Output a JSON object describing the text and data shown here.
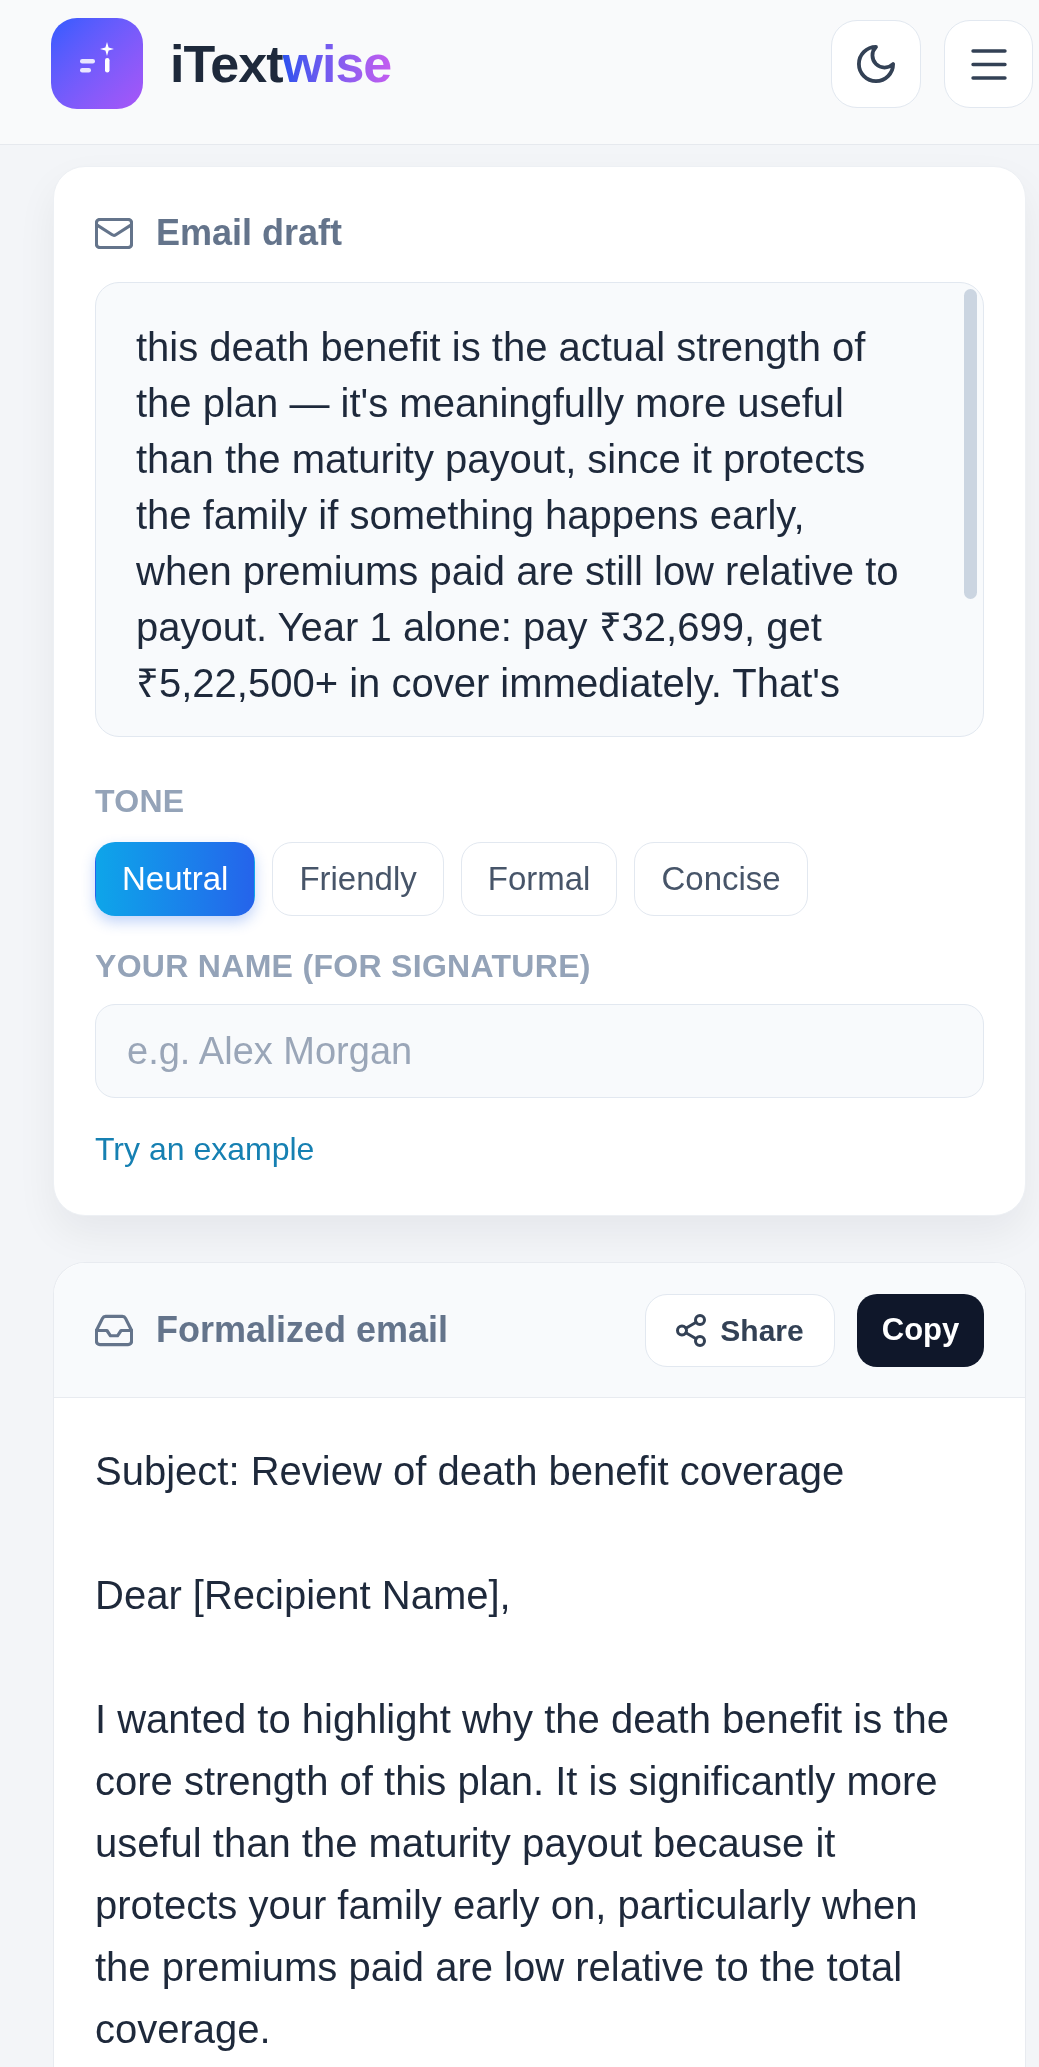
{
  "header": {
    "brand": {
      "text": "iText",
      "accent": "wise"
    }
  },
  "draft_card": {
    "title": "Email draft",
    "draft_text": "this death benefit is the actual strength of the plan — it's meaningfully more useful than the maturity payout, since it protects the family if something happens early, when premiums paid are still low relative to payout. Year 1 alone: pay ₹32,699, get ₹5,22,500+ in cover immediately. That's",
    "tone": {
      "label": "TONE",
      "options": [
        {
          "label": "Neutral",
          "selected": true
        },
        {
          "label": "Friendly",
          "selected": false
        },
        {
          "label": "Formal",
          "selected": false
        },
        {
          "label": "Concise",
          "selected": false
        }
      ]
    },
    "name_field": {
      "label": "YOUR NAME (FOR SIGNATURE)",
      "placeholder": "e.g. Alex Morgan"
    },
    "example_link": "Try an example"
  },
  "result_card": {
    "title": "Formalized email",
    "share_button": "Share",
    "copy_button": "Copy",
    "body": [
      "Subject: Review of death benefit coverage",
      "Dear [Recipient Name],",
      "I wanted to highlight why the death benefit is the core strength of this plan. It is significantly more useful than the maturity payout because it protects your family early on, particularly when the premiums paid are low relative to the total coverage."
    ]
  }
}
